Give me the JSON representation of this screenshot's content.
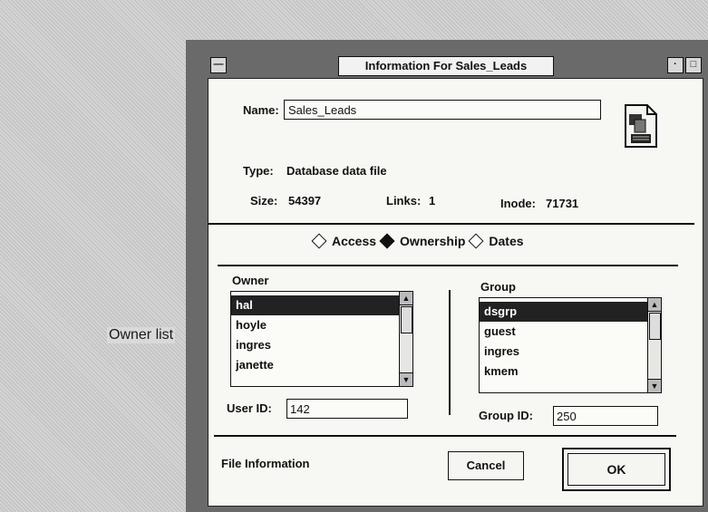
{
  "callout": {
    "text": "Owner list"
  },
  "window": {
    "title": "Information For Sales_Leads",
    "menu_glyph": "—",
    "min_glyph": "·",
    "max_glyph": "□"
  },
  "file": {
    "name_label": "Name:",
    "name_value": "Sales_Leads",
    "type_label": "Type:",
    "type_value": "Database data file",
    "size_label": "Size:",
    "size_value": "54397",
    "links_label": "Links:",
    "links_value": "1",
    "inode_label": "Inode:",
    "inode_value": "71731"
  },
  "tabs": [
    {
      "label": "Access",
      "selected": false
    },
    {
      "label": "Ownership",
      "selected": true
    },
    {
      "label": "Dates",
      "selected": false
    }
  ],
  "owner": {
    "label": "Owner",
    "items": [
      "hal",
      "hoyle",
      "ingres",
      "janette"
    ],
    "selected_index": 0,
    "id_label": "User ID:",
    "id_value": "142"
  },
  "group": {
    "label": "Group",
    "items": [
      "dsgrp",
      "guest",
      "ingres",
      "kmem"
    ],
    "selected_index": 0,
    "id_label": "Group ID:",
    "id_value": "250"
  },
  "footer": {
    "status": "File Information",
    "cancel_label": "Cancel",
    "ok_label": "OK"
  }
}
